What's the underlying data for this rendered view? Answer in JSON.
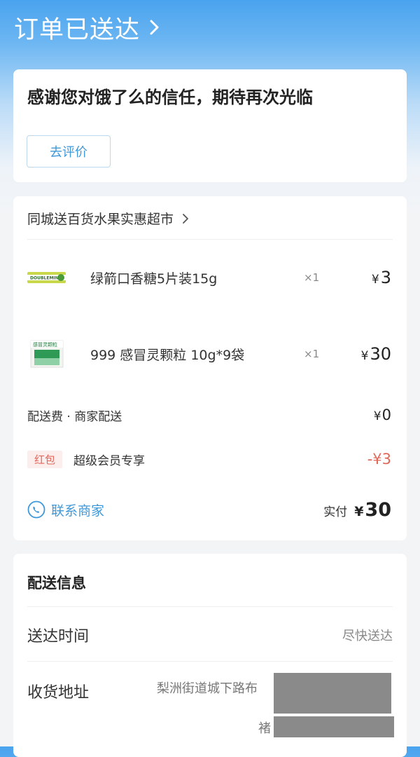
{
  "header": {
    "title": "订单已送达"
  },
  "thanks_card": {
    "message": "感谢您对饿了么的信任，期待再次光临",
    "review_button": "去评价"
  },
  "order": {
    "store_name": "同城送百货水果实惠超市",
    "items": [
      {
        "name": "绿箭口香糖5片装15g",
        "qty": "×1",
        "currency": "¥",
        "price": "3",
        "thumb_text": "DOUBLEMINT"
      },
      {
        "name": "999 感冒灵颗粒 10g*9袋",
        "qty": "×1",
        "currency": "¥",
        "price": "30",
        "thumb_text": "感冒灵颗粒"
      }
    ],
    "delivery_fee": {
      "label": "配送费 · 商家配送",
      "currency": "¥",
      "value": "0"
    },
    "red_packet": {
      "badge": "红包",
      "label": "超级会员专享",
      "value": "-¥3"
    },
    "contact_label": "联系商家",
    "paid_label": "实付",
    "paid_currency": "¥",
    "paid_value": "30"
  },
  "delivery_info": {
    "title": "配送信息",
    "time_label": "送达时间",
    "time_value": "尽快送达",
    "address_label": "收货地址",
    "address_line1": "梨洲街道城下路布",
    "address_line2": "褚"
  },
  "colors": {
    "accent": "#3f98d8",
    "header_blue": "#4aa3ee",
    "red": "#e0675a"
  },
  "icons": [
    "chevron-right-icon",
    "phone-icon"
  ]
}
